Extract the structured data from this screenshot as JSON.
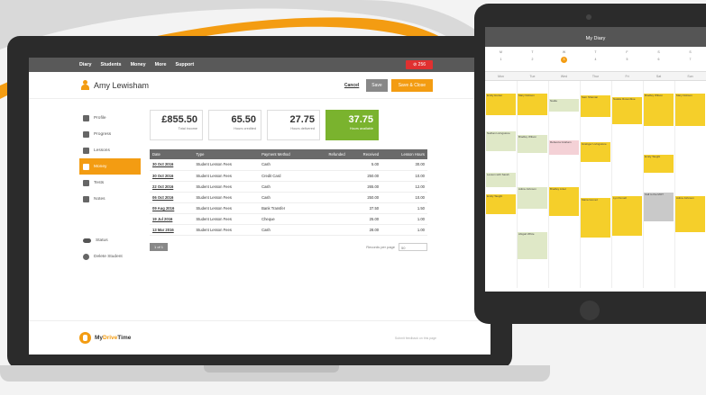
{
  "nav": {
    "items": [
      "Diary",
      "Students",
      "Money",
      "More",
      "Support"
    ],
    "alert_label": "⊘ 256"
  },
  "student": {
    "name": "Amy Lewisham"
  },
  "actions": {
    "cancel": "Cancel",
    "save": "Save",
    "save_close": "Save & Close"
  },
  "sidebar": {
    "items": [
      {
        "label": "Profile",
        "icon": "user-icon"
      },
      {
        "label": "Progress",
        "icon": "star-icon"
      },
      {
        "label": "Lessons",
        "icon": "car-icon"
      },
      {
        "label": "Money",
        "icon": "pound-icon"
      },
      {
        "label": "Tests",
        "icon": "gear-icon"
      },
      {
        "label": "Notes",
        "icon": "edit-icon"
      }
    ],
    "status": "Status",
    "delete": "Delete Student"
  },
  "stats": [
    {
      "value": "£855.50",
      "label": "Total income"
    },
    {
      "value": "65.50",
      "label": "Hours credited"
    },
    {
      "value": "27.75",
      "label": "Hours delivered"
    },
    {
      "value": "37.75",
      "label": "Hours available"
    }
  ],
  "table": {
    "headers": [
      "Date",
      "Type",
      "Payment Method",
      "Refunded",
      "Received",
      "Lesson Hours"
    ],
    "rows": [
      [
        "30 Oct 2016",
        "Student Lesson Fees",
        "Cash",
        "",
        "5.00",
        "30.00"
      ],
      [
        "30 Oct 2016",
        "Student Lesson Fees",
        "Credit Card",
        "",
        "250.00",
        "10.00"
      ],
      [
        "22 Oct 2016",
        "Student Lesson Fees",
        "Cash",
        "",
        "265.00",
        "12.00"
      ],
      [
        "06 Oct 2016",
        "Student Lesson Fees",
        "Cash",
        "",
        "250.00",
        "10.00"
      ],
      [
        "09 Aug 2016",
        "Student Lesson Fees",
        "Bank Transfer",
        "",
        "37.50",
        "1.50"
      ],
      [
        "19 Jul 2016",
        "Student Lesson Fees",
        "Cheque",
        "",
        "25.00",
        "1.00"
      ],
      [
        "13 Mar 2016",
        "Student Lesson Fees",
        "Cash",
        "",
        "28.00",
        "1.00"
      ]
    ]
  },
  "pager": {
    "page": "1 of 1",
    "per_page_label": "Records per page",
    "per_page_value": "50"
  },
  "footer": {
    "logo_a": "My",
    "logo_b": "Drive",
    "logo_c": "Time",
    "feedback": "Submit feedback on this page"
  },
  "tablet": {
    "title": "My Diary",
    "days": [
      {
        "d": "M",
        "n": "1"
      },
      {
        "d": "T",
        "n": "2"
      },
      {
        "d": "W",
        "n": "3"
      },
      {
        "d": "T",
        "n": "4"
      },
      {
        "d": "F",
        "n": "5"
      },
      {
        "d": "S",
        "n": "6"
      },
      {
        "d": "S",
        "n": "7"
      }
    ],
    "weekdays": [
      "Mon",
      "Tue",
      "Wed",
      "Thur",
      "Fri",
      "Sat",
      "Sun"
    ],
    "events": [
      {
        "t": "Emily Hunter",
        "c": "y"
      },
      {
        "t": "Mary Dobson",
        "c": "y"
      },
      {
        "t": "Nadia",
        "c": "g"
      },
      {
        "t": "Sam Shaman",
        "c": "y"
      },
      {
        "t": "Natalie Rosenblue",
        "c": "y"
      },
      {
        "t": "Bradley Wilson",
        "c": "y"
      },
      {
        "t": "Mary Dobson",
        "c": "y"
      },
      {
        "t": "Nathan Livingstone",
        "c": "g"
      },
      {
        "t": "Bradley Wilson",
        "c": "g"
      },
      {
        "t": "Rebecca Graham",
        "c": "p"
      },
      {
        "t": "Grainger Livingstone",
        "c": "y"
      },
      {
        "t": "Emily Taught",
        "c": "y"
      },
      {
        "t": "Lesson with Sarah",
        "c": "g"
      },
      {
        "t": "Adina Johnson",
        "c": "g"
      },
      {
        "t": "Bradley Antel",
        "c": "y"
      },
      {
        "t": "Emily Taught",
        "c": "y"
      },
      {
        "t": "Maria Gomez",
        "c": "y"
      },
      {
        "t": "Lyn Pemell",
        "c": "y"
      },
      {
        "t": "Call to the MOT",
        "c": "gr"
      },
      {
        "t": "Adina Johnson",
        "c": "y"
      },
      {
        "t": "Abigail White",
        "c": "g"
      }
    ]
  }
}
